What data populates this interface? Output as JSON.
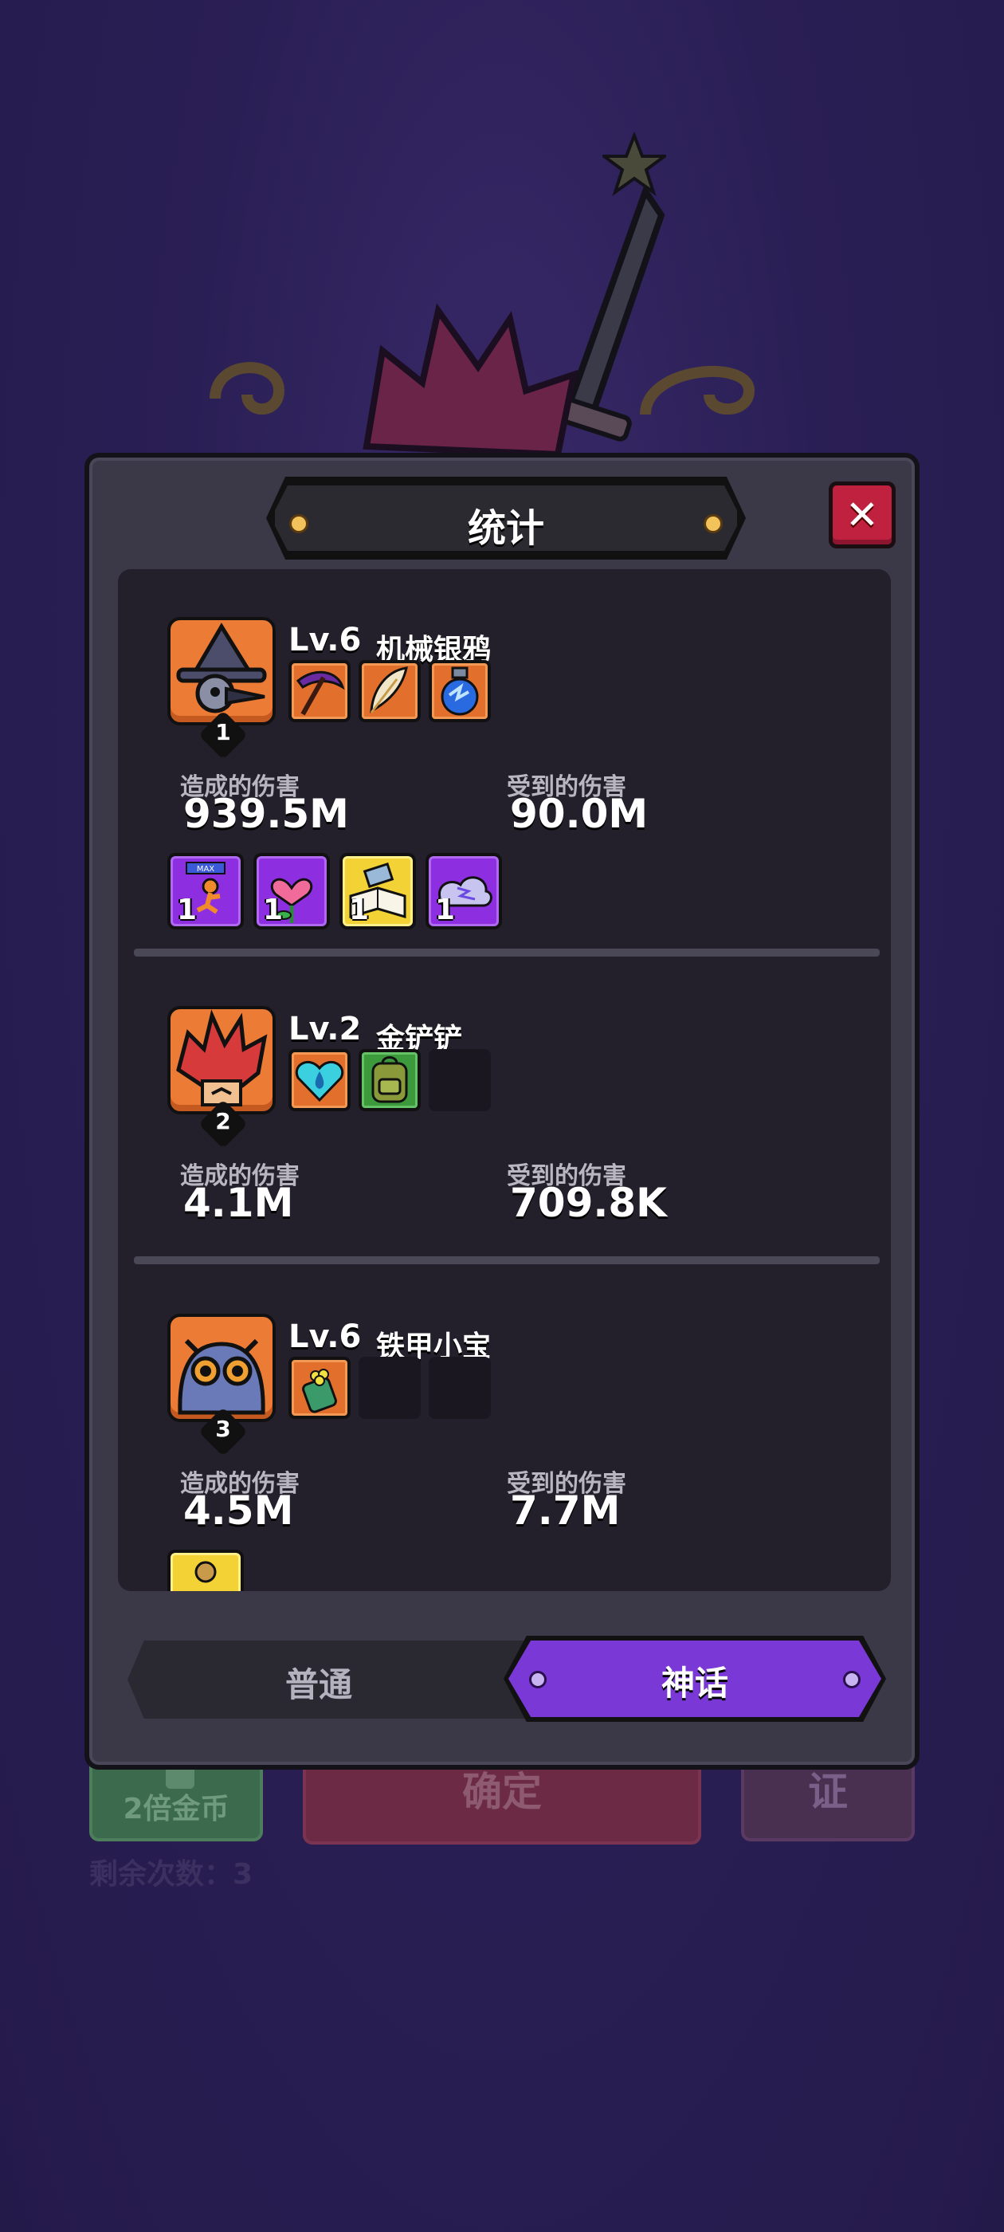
{
  "background": {
    "gold_button_label": "2倍金币",
    "confirm_button_label": "确定",
    "right_button_label": "证",
    "remaining_text": "剩余次数：3"
  },
  "dialog": {
    "title": "统计",
    "close_icon": "✕",
    "heroes": [
      {
        "rank": "1",
        "level": "Lv.6",
        "name": "机械银鸦",
        "portrait_icon": "crow-wizard-icon",
        "equipment": [
          "pickaxe-icon",
          "feather-icon",
          "potion-icon"
        ],
        "damage_dealt_label": "造成的伤害",
        "damage_dealt": "939.5M",
        "damage_taken_label": "受到的伤害",
        "damage_taken": "90.0M",
        "cards": [
          {
            "icon": "max-runner-icon",
            "count": "1",
            "color": "purple"
          },
          {
            "icon": "heart-flower-icon",
            "count": "1",
            "color": "purple"
          },
          {
            "icon": "book-icon",
            "count": "1",
            "color": "yellow"
          },
          {
            "icon": "lightning-cloud-icon",
            "count": "1",
            "color": "purple"
          }
        ]
      },
      {
        "rank": "2",
        "level": "Lv.2",
        "name": "金铲铲",
        "portrait_icon": "red-hair-hero-icon",
        "equipment": [
          "water-heart-icon",
          "backpack-icon"
        ],
        "damage_dealt_label": "造成的伤害",
        "damage_dealt": "4.1M",
        "damage_taken_label": "受到的伤害",
        "damage_taken": "709.8K"
      },
      {
        "rank": "3",
        "level": "Lv.6",
        "name": "铁甲小宝",
        "portrait_icon": "robot-goggles-icon",
        "equipment": [
          "flower-gem-icon"
        ],
        "damage_dealt_label": "造成的伤害",
        "damage_dealt": "4.5M",
        "damage_taken_label": "受到的伤害",
        "damage_taken": "7.7M"
      }
    ],
    "tabs": [
      {
        "label": "普通",
        "active": false
      },
      {
        "label": "神话",
        "active": true
      }
    ]
  },
  "colors": {
    "accent_purple": "#7a39d6",
    "close_red": "#c0213e",
    "portrait_orange": "#ec7b35"
  }
}
